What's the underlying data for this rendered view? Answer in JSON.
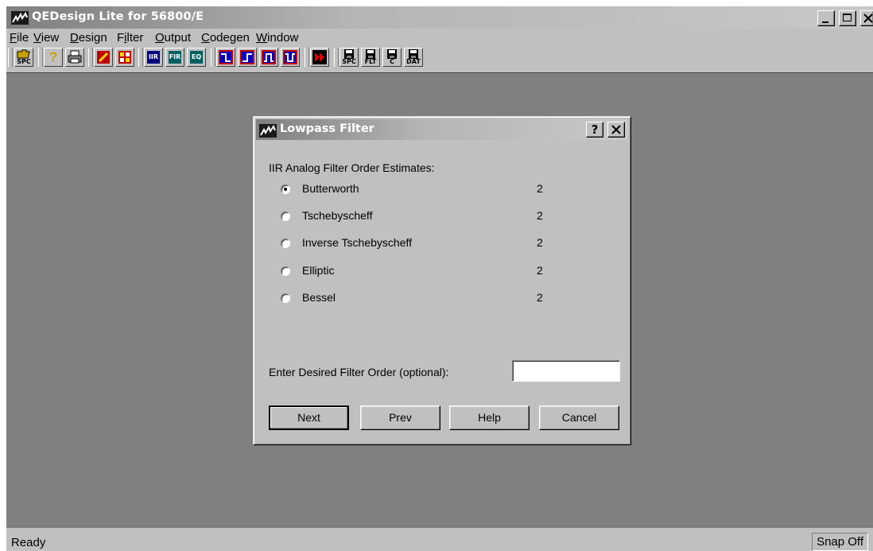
{
  "window": {
    "title": "QEDesign Lite for 56800/E"
  },
  "menu": [
    {
      "label": "File",
      "hotkey": "F",
      "rest": "ile"
    },
    {
      "label": "View",
      "hotkey": "V",
      "rest": "iew"
    },
    {
      "label": "Design",
      "hotkey": "D",
      "rest": "esign"
    },
    {
      "label": "Filter",
      "hotkey": "F",
      "rest": "ilter",
      "prefix": "F",
      "underline_index": 2
    },
    {
      "label": "Output",
      "hotkey": "O",
      "rest": "utput"
    },
    {
      "label": "Codegen",
      "hotkey": "C",
      "rest": "odegen"
    },
    {
      "label": "Window",
      "hotkey": "W",
      "rest": "indow"
    }
  ],
  "toolbar": {
    "open_label": "SPC",
    "iir_label": "IIR",
    "fir_label": "FIR",
    "eq_label": "EQ",
    "save_spc_label": "SPC",
    "save_flt_label": "FLT",
    "save_c_label": "C",
    "save_dat_label": "DAT"
  },
  "dialog": {
    "title": "Lowpass Filter",
    "help_glyph": "?",
    "close_glyph": "✕",
    "section_label": "IIR Analog Filter Order Estimates:",
    "options": [
      {
        "label": "Butterworth",
        "order": "2",
        "selected": true
      },
      {
        "label": "Tschebyscheff",
        "order": "2",
        "selected": false
      },
      {
        "label": "Inverse Tschebyscheff",
        "order": "2",
        "selected": false
      },
      {
        "label": "Elliptic",
        "order": "2",
        "selected": false
      },
      {
        "label": "Bessel",
        "order": "2",
        "selected": false
      }
    ],
    "order_prompt": "Enter Desired Filter Order (optional):",
    "order_value": "",
    "buttons": {
      "next": "Next",
      "prev": "Prev",
      "help": "Help",
      "cancel": "Cancel"
    }
  },
  "status": {
    "text": "Ready",
    "snap": "Snap Off"
  },
  "colors": {
    "workspace": "#808080",
    "face": "#c0c0c0",
    "toolbar_dark": "#000080",
    "toolbar_red": "#c00000",
    "toolbar_blue": "#0000c0"
  },
  "icons": [
    "app-logo-icon",
    "open-folder-icon",
    "help-icon",
    "print-icon",
    "edit-icon",
    "grid-icon",
    "lowpass-icon",
    "highpass-icon",
    "bandpass-icon",
    "bandstop-icon",
    "run-icon",
    "save-disk-icon"
  ]
}
